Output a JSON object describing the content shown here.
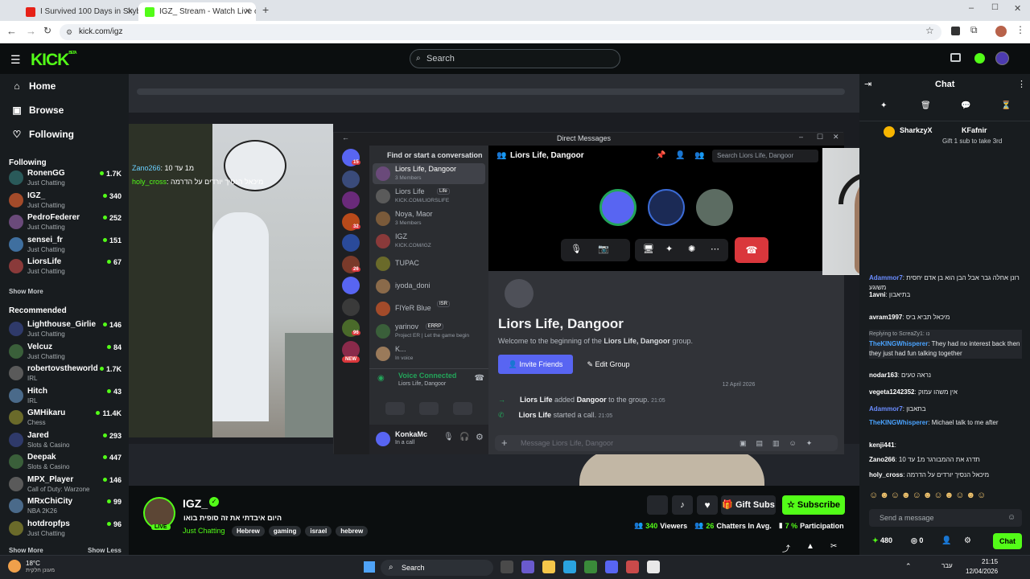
{
  "browser": {
    "tabs": [
      {
        "title": "I Survived 100 Days in Skyblock",
        "favicon": "youtube-icon"
      },
      {
        "title": "IGZ_ Stream - Watch Live on Ki",
        "favicon": "kick-icon"
      }
    ],
    "url": "kick.com/igz"
  },
  "kick": {
    "logo": "KICK",
    "logo_beta": "BETA",
    "search_placeholder": "Search",
    "nav": [
      {
        "label": "Home",
        "icon": "home-icon"
      },
      {
        "label": "Browse",
        "icon": "browse-icon"
      },
      {
        "label": "Following",
        "icon": "heart-icon"
      }
    ],
    "following_title": "Following",
    "following": [
      {
        "name": "RonenGG",
        "category": "Just Chatting",
        "viewers": "1.7K"
      },
      {
        "name": "IGZ_",
        "category": "Just Chatting",
        "viewers": "340"
      },
      {
        "name": "PedroFederer",
        "category": "Just Chatting",
        "viewers": "252"
      },
      {
        "name": "sensei_fr",
        "category": "Just Chatting",
        "viewers": "151"
      },
      {
        "name": "LiorsLife",
        "category": "Just Chatting",
        "viewers": "67"
      }
    ],
    "show_more": "Show More",
    "recommended_title": "Recommended",
    "recommended": [
      {
        "name": "Lighthouse_Girlie",
        "category": "Just Chatting",
        "viewers": "146"
      },
      {
        "name": "Velcuz",
        "category": "Just Chatting",
        "viewers": "84"
      },
      {
        "name": "robertovstheworld",
        "category": "IRL",
        "viewers": "1.7K"
      },
      {
        "name": "Hitch",
        "category": "IRL",
        "viewers": "43"
      },
      {
        "name": "GMHikaru",
        "category": "Chess",
        "viewers": "11.4K"
      },
      {
        "name": "Jared",
        "category": "Slots & Casino",
        "viewers": "293"
      },
      {
        "name": "Deepak",
        "category": "Slots & Casino",
        "viewers": "447"
      },
      {
        "name": "MPX_Player",
        "category": "Call of Duty: Warzone",
        "viewers": "146"
      },
      {
        "name": "MRxChiCity",
        "category": "NBA 2K26",
        "viewers": "99"
      },
      {
        "name": "hotdropfps",
        "category": "Just Chatting",
        "viewers": "96"
      }
    ],
    "show_less": "Show Less"
  },
  "stream_overlay": {
    "chat_lines": [
      {
        "user": "Zano266",
        "text": ": מ1 עד 10"
      },
      {
        "user": "holy_cross",
        "text": ": מיכאל הנסיך יורדים על הדרמה"
      }
    ]
  },
  "discord": {
    "window_title": "Direct Messages",
    "find_conversation": "Find or start a conversation",
    "dm_list": [
      {
        "name": "Liors Life, Dangoor",
        "sub": "3 Members"
      },
      {
        "name": "Liors Life",
        "sub": "KICK.COM/LIORSLIFE",
        "badge": "Life"
      },
      {
        "name": "Noya, Maor",
        "sub": "3 Members"
      },
      {
        "name": "IGZ",
        "sub": "KICK.COM/IGZ"
      },
      {
        "name": "TUPAC",
        "sub": ""
      },
      {
        "name": "iyoda_doni",
        "sub": ""
      },
      {
        "name": "FlYeR Blue",
        "sub": "",
        "badge": "ISR"
      },
      {
        "name": "yarinov",
        "sub": "Project ER | Let the game begin",
        "badge": "ERRP"
      },
      {
        "name": "K...",
        "sub": "In voice"
      }
    ],
    "server_badges": [
      "15",
      "32",
      "26",
      "96"
    ],
    "new_label": "NEW",
    "voice_connected": "Voice Connected",
    "voice_channel": "Liors Life, Dangoor",
    "user_name": "KonkaMc",
    "user_status": "In a call",
    "dm_header": "Liors Life, Dangoor",
    "search_placeholder": "Search Liors Life, Dangoor",
    "group_title": "Liors Life, Dangoor",
    "welcome_prefix": "Welcome to the beginning of the ",
    "welcome_group": "Liors Life, Dangoor",
    "welcome_suffix": " group.",
    "invite_button": "Invite Friends",
    "edit_button": "Edit Group",
    "date_divider": "12 April 2026",
    "events": [
      {
        "actor": "Liors Life",
        "action": "added",
        "target": "Dangoor",
        "rest": "to the group.",
        "time": "21:05"
      },
      {
        "actor": "Liors Life",
        "action": "started a call.",
        "target": "",
        "rest": "",
        "time": "21:05"
      }
    ],
    "message_placeholder": "Message Liors Life, Dangoor"
  },
  "channel": {
    "name": "IGZ_",
    "live": "LIVE",
    "title": "היום איבדתי את זה סופית בואו",
    "category": "Just Chatting",
    "tags": [
      "Hebrew",
      "gaming",
      "israel",
      "hebrew"
    ],
    "gift_subs": "Gift Subs",
    "subscribe": "Subscribe",
    "viewers_count": "340",
    "viewers_label": "Viewers",
    "chatters_count": "26",
    "chatters_label": "Chatters In Avg.",
    "participation_count": "7 %",
    "participation_label": "Participation"
  },
  "chat": {
    "title": "Chat",
    "pinned_users": [
      {
        "name": "SharkzyX",
        "badge": "1"
      },
      {
        "name": "KFafnir",
        "badge": "1"
      }
    ],
    "gift_banner": "Gift 1 sub to take 3rd",
    "messages": [
      {
        "user": "Adammor7",
        "color": "#6a8cff",
        "text": "רונן אחלה גבר אבל הבן הוא בן אדם יחסית משוגע"
      },
      {
        "user": "1avni",
        "color": "#ffffff",
        "text": "בתיאבון"
      },
      {
        "user": "avram1997",
        "color": "#ffffff",
        "text": "מיכאל תביא ביס"
      },
      {
        "user": "TheKINGWhisperer",
        "color": "#4aa3ff",
        "text": "They had no interest back then they just had fun talking together",
        "reply": "Replying to ScreaZy1: נו"
      },
      {
        "user": "nodar163",
        "color": "#ffffff",
        "text": "נראה טעים"
      },
      {
        "user": "vegeta1242352",
        "color": "#ffffff",
        "text": "אין משהו עמוק"
      },
      {
        "user": "Adammor7",
        "color": "#6a8cff",
        "text": "בתאבון"
      },
      {
        "user": "TheKINGWhisperer",
        "color": "#4aa3ff",
        "text": "Michael talk to me after"
      },
      {
        "user": "kenji441",
        "color": "#ffffff",
        "text": ""
      },
      {
        "user": "Zano266",
        "color": "#ffffff",
        "text": "תדרג את ההמבורגר מ1 עד 10"
      },
      {
        "user": "holy_cross",
        "color": "#ffffff",
        "text": "מיכאל הנסיך יורדים על הדרמה"
      }
    ],
    "send_placeholder": "Send a message",
    "points": "480",
    "other_count": "0",
    "chat_button": "Chat"
  },
  "taskbar": {
    "weather_temp": "18°C",
    "weather_desc": "מעונן חלקית",
    "search": "Search",
    "lang": "עבר",
    "time": "21:15",
    "date": "12/04/2026"
  },
  "colors": {
    "kick_green": "#53fc18",
    "discord_blurple": "#5865f2",
    "hangup_red": "#da373c"
  }
}
